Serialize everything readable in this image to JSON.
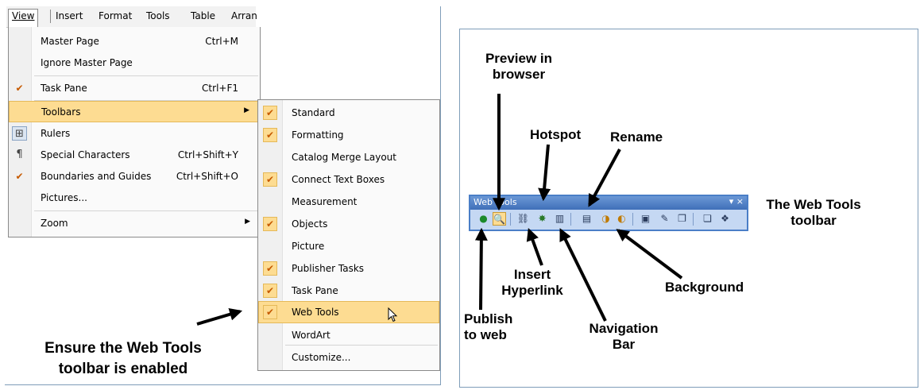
{
  "menubar": {
    "items": [
      "View",
      "Insert",
      "Format",
      "Tools",
      "Table",
      "Arran"
    ]
  },
  "view_menu": {
    "items": [
      {
        "label": "Master Page",
        "shortcut": "Ctrl+M",
        "icon": ""
      },
      {
        "label": "Ignore Master Page",
        "shortcut": "",
        "icon": ""
      },
      {
        "label": "Task Pane",
        "shortcut": "Ctrl+F1",
        "icon": "checkmark-icon"
      },
      {
        "label": "Toolbars",
        "shortcut": "",
        "icon": "",
        "submenu": true,
        "highlighted": true
      },
      {
        "label": "Rulers",
        "shortcut": "",
        "icon": "rulers-icon"
      },
      {
        "label": "Special Characters",
        "shortcut": "Ctrl+Shift+Y",
        "icon": "pilcrow-icon"
      },
      {
        "label": "Boundaries and Guides",
        "shortcut": "Ctrl+Shift+O",
        "icon": "checkmark-icon"
      },
      {
        "label": "Pictures...",
        "shortcut": "",
        "icon": ""
      },
      {
        "label": "Zoom",
        "shortcut": "",
        "icon": "",
        "submenu": true
      }
    ]
  },
  "toolbars_submenu": {
    "items": [
      {
        "label": "Standard",
        "checked": true
      },
      {
        "label": "Formatting",
        "checked": true
      },
      {
        "label": "Catalog Merge Layout",
        "checked": false
      },
      {
        "label": "Connect Text Boxes",
        "checked": true
      },
      {
        "label": "Measurement",
        "checked": false
      },
      {
        "label": "Objects",
        "checked": true
      },
      {
        "label": "Picture",
        "checked": false
      },
      {
        "label": "Publisher Tasks",
        "checked": true
      },
      {
        "label": "Task Pane",
        "checked": true
      },
      {
        "label": "Web Tools",
        "checked": true,
        "highlighted": true
      },
      {
        "label": "WordArt",
        "checked": false
      },
      {
        "label": "Customize...",
        "checked": false
      }
    ]
  },
  "callouts": {
    "ensure_line1": "Ensure the Web Tools",
    "ensure_line2": "toolbar is enabled",
    "preview_line1": "Preview in",
    "preview_line2": "browser",
    "hotspot": "Hotspot",
    "rename": "Rename",
    "web_tools_line1": "The Web Tools",
    "web_tools_line2": "toolbar",
    "insert_line1": "Insert",
    "insert_line2": "Hyperlink",
    "background": "Background",
    "publish_line1": "Publish",
    "publish_line2": "to web",
    "nav_line1": "Navigation",
    "nav_line2": "Bar"
  },
  "web_toolbar": {
    "title": "Web Tools",
    "controls": "▾ ×",
    "buttons": [
      {
        "name": "publish-to-web-icon",
        "glyph": "●"
      },
      {
        "name": "preview-in-browser-icon",
        "glyph": "🔍"
      },
      {
        "name": "insert-hyperlink-icon",
        "glyph": "⛓"
      },
      {
        "name": "hotspot-icon",
        "glyph": "✸"
      },
      {
        "name": "navigation-bar-icon",
        "glyph": "▥"
      },
      {
        "name": "rename-icon",
        "glyph": "▤"
      },
      {
        "name": "web-page-options-icon",
        "glyph": "◑"
      },
      {
        "name": "background-icon",
        "glyph": "◐"
      },
      {
        "name": "form-control-icon",
        "glyph": "▣"
      },
      {
        "name": "html-code-icon",
        "glyph": "✎"
      },
      {
        "name": "insert-page-icon",
        "glyph": "❐"
      },
      {
        "name": "web-site-options-icon",
        "glyph": "❏"
      },
      {
        "name": "design-checker-icon",
        "glyph": "❖"
      }
    ]
  }
}
